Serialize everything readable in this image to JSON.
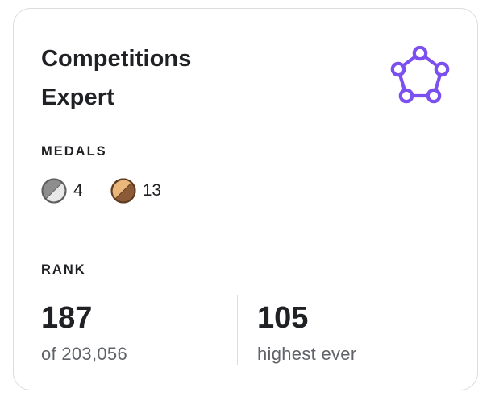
{
  "card": {
    "title_line1": "Competitions",
    "title_line2": "Expert",
    "tier_icon": "expert-tier-pentagon-icon",
    "accent_color": "#7b4ff0"
  },
  "medals": {
    "label": "MEDALS",
    "items": [
      {
        "icon": "silver-medal-icon",
        "count": "4",
        "color": "#8e8e8e"
      },
      {
        "icon": "bronze-medal-icon",
        "count": "13",
        "color": "#8b5a36"
      }
    ]
  },
  "rank": {
    "label": "RANK",
    "current": {
      "value": "187",
      "caption": "of 203,056"
    },
    "highest": {
      "value": "105",
      "caption": "highest ever"
    }
  }
}
